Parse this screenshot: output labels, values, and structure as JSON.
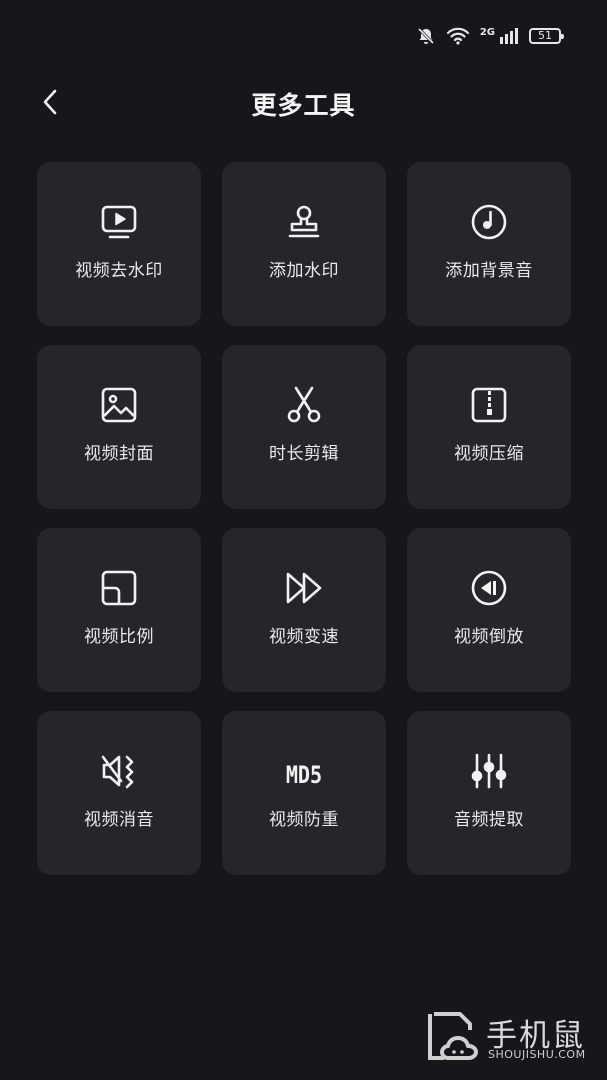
{
  "status_bar": {
    "network_type": "2G",
    "battery_level": "51",
    "icons": [
      "bell-muted-icon",
      "wifi-icon",
      "signal-icon",
      "battery-icon"
    ]
  },
  "header": {
    "title": "更多工具",
    "back_icon": "chevron-left-icon"
  },
  "tools": [
    {
      "label": "视频去水印",
      "icon": "video-play-icon"
    },
    {
      "label": "添加水印",
      "icon": "stamp-icon"
    },
    {
      "label": "添加背景音",
      "icon": "music-disc-icon"
    },
    {
      "label": "视频封面",
      "icon": "image-icon"
    },
    {
      "label": "时长剪辑",
      "icon": "scissors-icon"
    },
    {
      "label": "视频压缩",
      "icon": "zip-icon"
    },
    {
      "label": "视频比例",
      "icon": "aspect-ratio-icon"
    },
    {
      "label": "视频变速",
      "icon": "fast-forward-icon"
    },
    {
      "label": "视频倒放",
      "icon": "rewind-icon"
    },
    {
      "label": "视频消音",
      "icon": "mute-icon"
    },
    {
      "label": "视频防重",
      "icon": "md5-icon",
      "icon_text": "MD5"
    },
    {
      "label": "音频提取",
      "icon": "equalizer-icon"
    }
  ],
  "watermark": {
    "text_cn": "手机鼠",
    "text_en": "SHOUJISHU.COM"
  }
}
